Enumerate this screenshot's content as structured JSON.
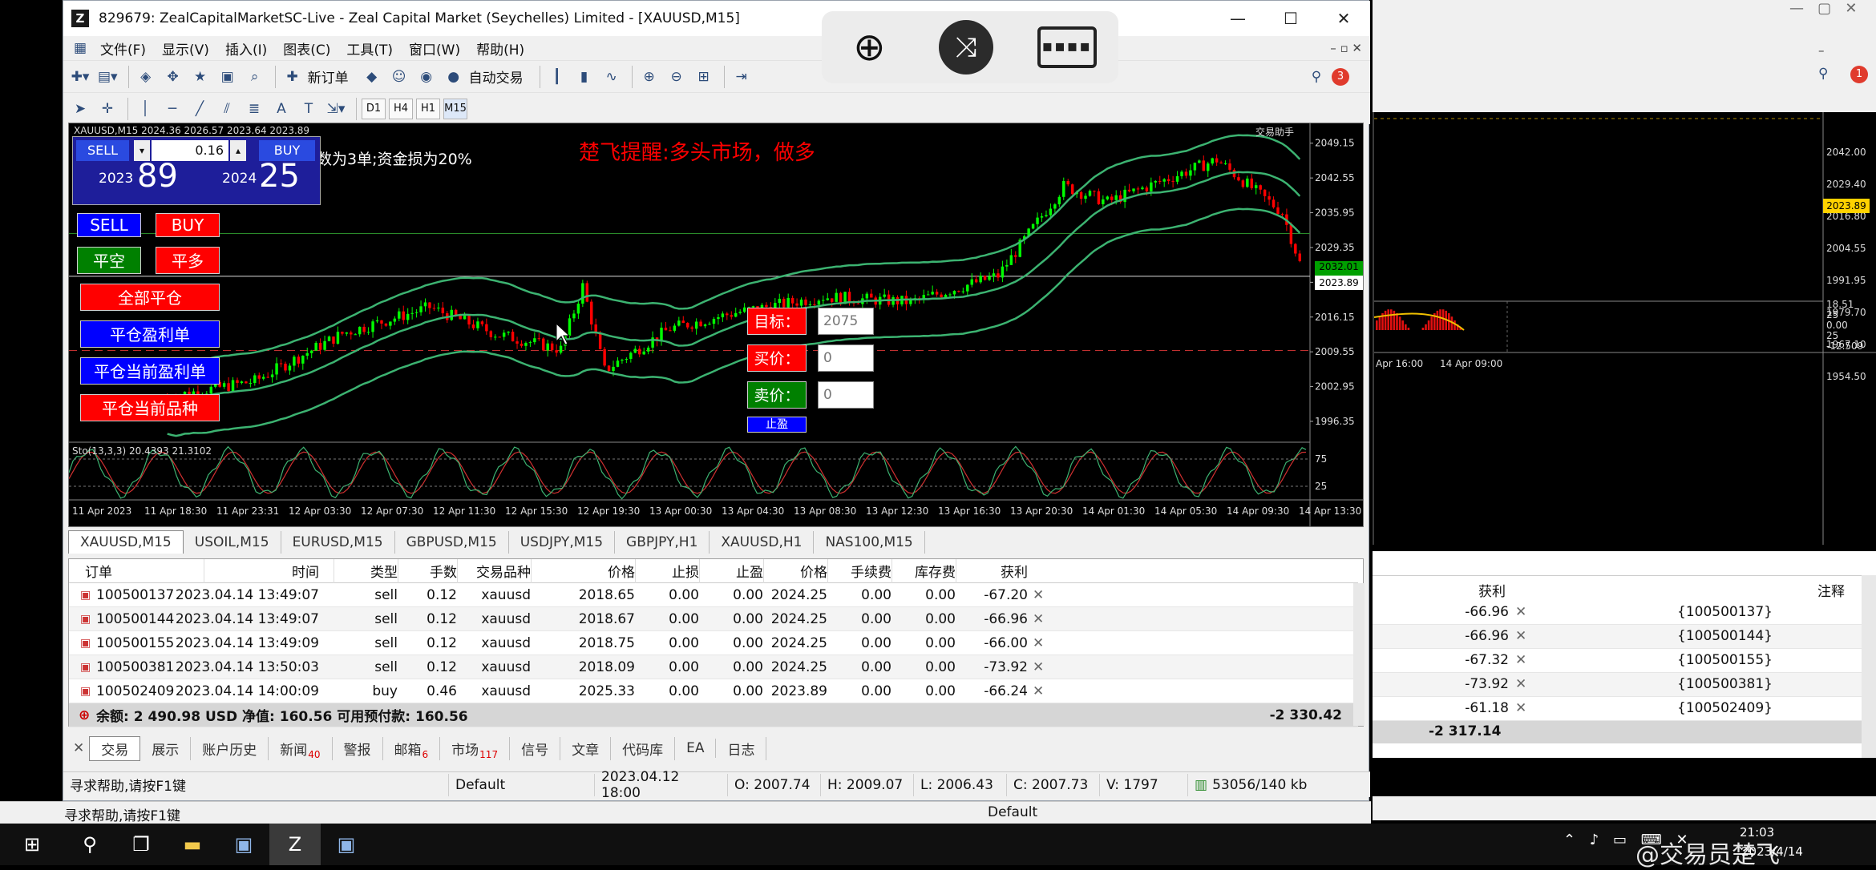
{
  "window": {
    "title": "829679: ZealCapitalMarketSC-Live - Zeal Capital Market (Seychelles) Limited - [XAUUSD,M15]",
    "minimize": "—",
    "maximize": "☐",
    "close": "✕"
  },
  "menu": [
    "文件(F)",
    "显示(V)",
    "插入(I)",
    "图表(C)",
    "工具(T)",
    "窗口(W)",
    "帮助(H)"
  ],
  "toolbar": {
    "new_order": "新订单",
    "auto_trade": "自动交易",
    "alert_count": "3"
  },
  "timeframes": [
    "D1",
    "H4",
    "H1",
    "M15"
  ],
  "chart": {
    "header": "XAUUSD,M15  2024.36 2026.57 2023.64 2023.89",
    "notice": "楚飞提醒:多头市场，做多",
    "info_text": "仓数为3单;资金损为20%",
    "trade_panel": {
      "sell": "SELL",
      "buy": "BUY",
      "lots": "0.16",
      "sell_big": "89",
      "sell_prefix": "2023",
      "buy_big": "25",
      "buy_prefix": "2024"
    },
    "buttons": {
      "sell": "SELL",
      "buy": "BUY",
      "close_short": "平空",
      "close_long": "平多",
      "close_all": "全部平仓",
      "close_profit": "平仓盈利单",
      "close_cur_profit": "平仓当前盈利单",
      "close_cur_symbol": "平仓当前品种"
    },
    "fields": {
      "target_label": "目标：",
      "target_value": "2075",
      "buy_label": "买价：",
      "buy_value": "0",
      "sell_label": "卖价：",
      "sell_value": "0",
      "extra_label": "止盈"
    },
    "price_axis": [
      "2049.15",
      "2042.55",
      "2035.95",
      "2029.35",
      "2022.75",
      "2016.15",
      "2009.55",
      "2002.95",
      "1996.35"
    ],
    "current_price": "2023.89",
    "green_price": "2032.01",
    "ind_header": "Sto(13,3,3) 20.4393 21.3102",
    "ind_axis": [
      "75",
      "25"
    ],
    "time_axis": [
      "11 Apr 2023",
      "11 Apr 18:30",
      "11 Apr 23:31",
      "12 Apr 03:30",
      "12 Apr 07:30",
      "12 Apr 11:30",
      "12 Apr 15:30",
      "12 Apr 19:30",
      "13 Apr 00:30",
      "13 Apr 04:30",
      "13 Apr 08:30",
      "13 Apr 12:30",
      "13 Apr 16:30",
      "13 Apr 20:30",
      "14 Apr 01:30",
      "14 Apr 05:30",
      "14 Apr 09:30",
      "14 Apr 13:30"
    ],
    "corner_label": "交易助手"
  },
  "right_chart": {
    "price_axis": [
      "2042.00",
      "2029.40",
      "2016.80",
      "2004.55",
      "1991.95",
      "1979.70",
      "1967.10",
      "1954.50"
    ],
    "current": "2023.89",
    "ind_axis": [
      "18.51",
      "25",
      "0.00",
      "25",
      "-12.509"
    ],
    "time_axis": [
      "Apr 16:00",
      "14 Apr 09:00"
    ]
  },
  "symbol_tabs": [
    "XAUUSD,M15",
    "USOIL,M15",
    "EURUSD,M15",
    "GBPUSD,M15",
    "USDJPY,M15",
    "GBPJPY,H1",
    "XAUUSD,H1",
    "NAS100,M15"
  ],
  "table": {
    "headers": [
      "订单",
      "时间",
      "类型",
      "手数",
      "交易品种",
      "价格",
      "止损",
      "止盈",
      "价格",
      "手续费",
      "库存费",
      "获利"
    ],
    "rows": [
      [
        "100500137",
        "2023.04.14 13:49:07",
        "sell",
        "0.12",
        "xauusd",
        "2018.65",
        "0.00",
        "0.00",
        "2024.25",
        "0.00",
        "0.00",
        "-67.20"
      ],
      [
        "100500144",
        "2023.04.14 13:49:07",
        "sell",
        "0.12",
        "xauusd",
        "2018.67",
        "0.00",
        "0.00",
        "2024.25",
        "0.00",
        "0.00",
        "-66.96"
      ],
      [
        "100500155",
        "2023.04.14 13:49:09",
        "sell",
        "0.12",
        "xauusd",
        "2018.75",
        "0.00",
        "0.00",
        "2024.25",
        "0.00",
        "0.00",
        "-66.00"
      ],
      [
        "100500381",
        "2023.04.14 13:50:03",
        "sell",
        "0.12",
        "xauusd",
        "2018.09",
        "0.00",
        "0.00",
        "2024.25",
        "0.00",
        "0.00",
        "-73.92"
      ],
      [
        "100502409",
        "2023.04.14 14:00:09",
        "buy",
        "0.46",
        "xauusd",
        "2025.33",
        "0.00",
        "0.00",
        "2023.89",
        "0.00",
        "0.00",
        "-66.24"
      ]
    ],
    "summary": "余额: 2 490.98 USD  净值: 160.56  可用预付款: 160.56",
    "total": "-2 330.42"
  },
  "bottom_tabs": [
    {
      "label": "交易",
      "badge": ""
    },
    {
      "label": "展示",
      "badge": ""
    },
    {
      "label": "账户历史",
      "badge": ""
    },
    {
      "label": "新闻",
      "badge": "40"
    },
    {
      "label": "警报",
      "badge": ""
    },
    {
      "label": "邮箱",
      "badge": "6"
    },
    {
      "label": "市场",
      "badge": "117"
    },
    {
      "label": "信号",
      "badge": ""
    },
    {
      "label": "文章",
      "badge": ""
    },
    {
      "label": "代码库",
      "badge": ""
    },
    {
      "label": "EA",
      "badge": ""
    },
    {
      "label": "日志",
      "badge": ""
    }
  ],
  "status": {
    "help": "寻求帮助,请按F1键",
    "profile": "Default",
    "time": "2023.04.12 18:00",
    "o": "O: 2007.74",
    "h": "H: 2009.07",
    "l": "L: 2006.43",
    "c": "C: 2007.73",
    "v": "V: 1797",
    "traffic": "53056/140 kb"
  },
  "status2": {
    "help": "寻求帮助,请按F1键",
    "profile": "Default"
  },
  "right_terminal": {
    "h_profit": "获利",
    "h_comment": "注释",
    "rows": [
      [
        "-66.96",
        "{100500137}"
      ],
      [
        "-66.96",
        "{100500144}"
      ],
      [
        "-67.32",
        "{100500155}"
      ],
      [
        "-73.92",
        "{100500381}"
      ],
      [
        "-61.18",
        "{100502409}"
      ]
    ],
    "total": "-2 317.14",
    "alert_count": "1"
  },
  "taskbar": {
    "time": "21:03",
    "date": "2023/4/14",
    "watermark": "@交易员楚飞"
  },
  "colors": {
    "chart_bg": "#000000",
    "candle_up": "#00ff00",
    "candle_down": "#ff0000",
    "band": "#3cb371",
    "text_red": "#ff0000"
  }
}
